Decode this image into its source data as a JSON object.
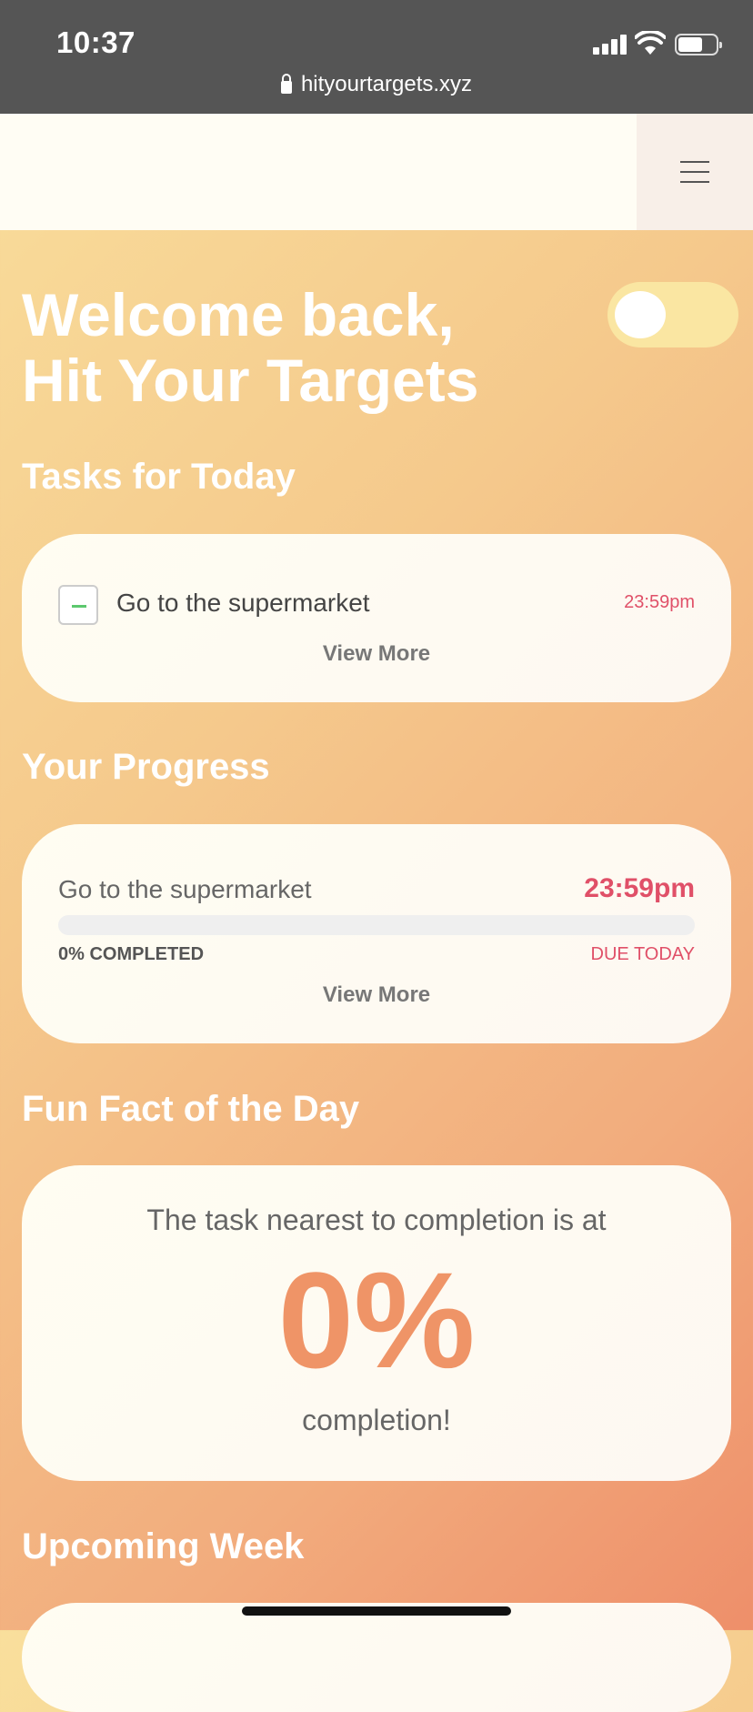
{
  "status_bar": {
    "time": "10:37",
    "url": "hityourtargets.xyz",
    "icons": [
      "signal-icon",
      "wifi-icon",
      "battery-icon"
    ]
  },
  "header": {
    "menu_icon": "hamburger-menu-icon"
  },
  "welcome": {
    "title": "Welcome back, Hit Your Targets",
    "theme_toggle_on": false
  },
  "tasks_today": {
    "title": "Tasks for Today",
    "items": [
      {
        "name": "Go to the supermarket",
        "due": "23:59pm"
      }
    ],
    "view_more": "View More"
  },
  "progress": {
    "title": "Your Progress",
    "items": [
      {
        "name": "Go to the supermarket",
        "due_time": "23:59pm",
        "percent": 0,
        "completed_label": "0% COMPLETED",
        "due_label": "DUE TODAY"
      }
    ],
    "view_more": "View More"
  },
  "fun_fact": {
    "title": "Fun Fact of the Day",
    "line1": "The task nearest to completion is at",
    "value": "0%",
    "line2": "completion!"
  },
  "upcoming": {
    "title": "Upcoming Week"
  },
  "colors": {
    "accent": "#ef9467",
    "due": "#e05068",
    "check": "#5cc86e"
  }
}
